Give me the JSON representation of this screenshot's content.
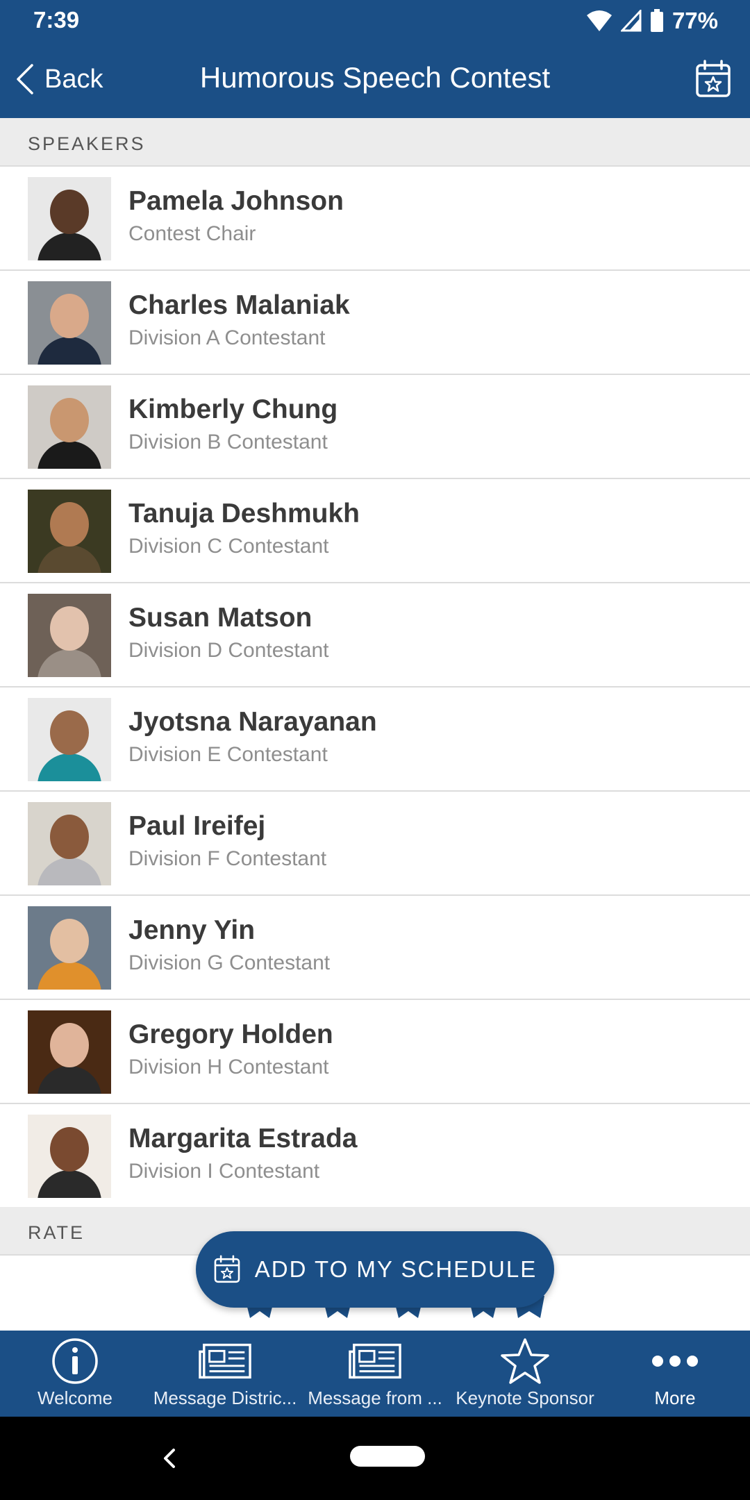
{
  "status_bar": {
    "time": "7:39",
    "battery": "77%"
  },
  "app_bar": {
    "back_label": "Back",
    "title": "Humorous Speech Contest"
  },
  "sections": {
    "speakers": "SPEAKERS",
    "rate": "RATE"
  },
  "speakers": [
    {
      "name": "Pamela Johnson",
      "role": "Contest Chair"
    },
    {
      "name": "Charles Malaniak",
      "role": "Division A Contestant"
    },
    {
      "name": "Kimberly Chung",
      "role": "Division B Contestant"
    },
    {
      "name": "Tanuja Deshmukh",
      "role": "Division C Contestant"
    },
    {
      "name": "Susan Matson",
      "role": "Division D Contestant"
    },
    {
      "name": "Jyotsna Narayanan",
      "role": "Division E Contestant"
    },
    {
      "name": "Paul Ireifej",
      "role": "Division F Contestant"
    },
    {
      "name": "Jenny Yin",
      "role": "Division G Contestant"
    },
    {
      "name": "Gregory Holden",
      "role": "Division H Contestant"
    },
    {
      "name": "Margarita Estrada",
      "role": "Division I Contestant"
    }
  ],
  "add_button": {
    "label": "ADD TO MY SCHEDULE",
    "icon": "calendar-star-icon"
  },
  "tabs": [
    {
      "label": "Welcome",
      "icon": "info-icon"
    },
    {
      "label": "Message Distric...",
      "icon": "newspaper-icon"
    },
    {
      "label": "Message from ...",
      "icon": "newspaper-icon"
    },
    {
      "label": "Keynote Sponsor",
      "icon": "star-icon"
    },
    {
      "label": "More",
      "icon": "more-icon"
    }
  ],
  "colors": {
    "brand": "#1b4f86",
    "section_bg": "#ececec",
    "name_text": "#3a3a3a",
    "role_text": "#8e8e8e"
  }
}
